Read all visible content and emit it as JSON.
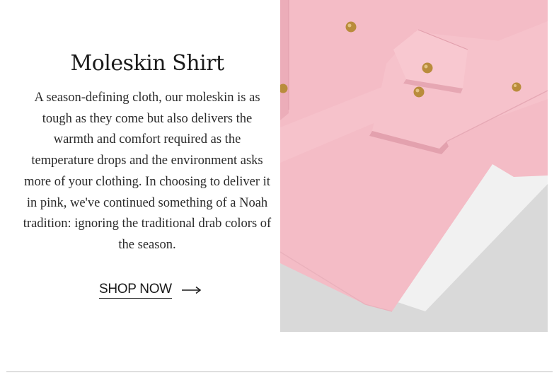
{
  "product": {
    "title": "Moleskin Shirt",
    "description": "A season-defining cloth, our moleskin is as tough as they come but also delivers the warmth and comfort required as the temperature drops and the environment asks more of your clothing. In choosing to deliver it in pink, we've continued something of a Noah tradition: ignoring the traditional drab colors of the season.",
    "cta_label": "SHOP NOW",
    "cta_icon": "arrow-right-icon"
  },
  "photo": {
    "subject": "pink moleskin shirt",
    "colors": {
      "fabric": "#f4bcc6",
      "fabric_shadow": "#e6a7b3",
      "button": "#b98c3c",
      "background": "#f0f0f0"
    }
  },
  "colors": {
    "text": "#1a1a1a",
    "divider": "#bdbdbd"
  }
}
